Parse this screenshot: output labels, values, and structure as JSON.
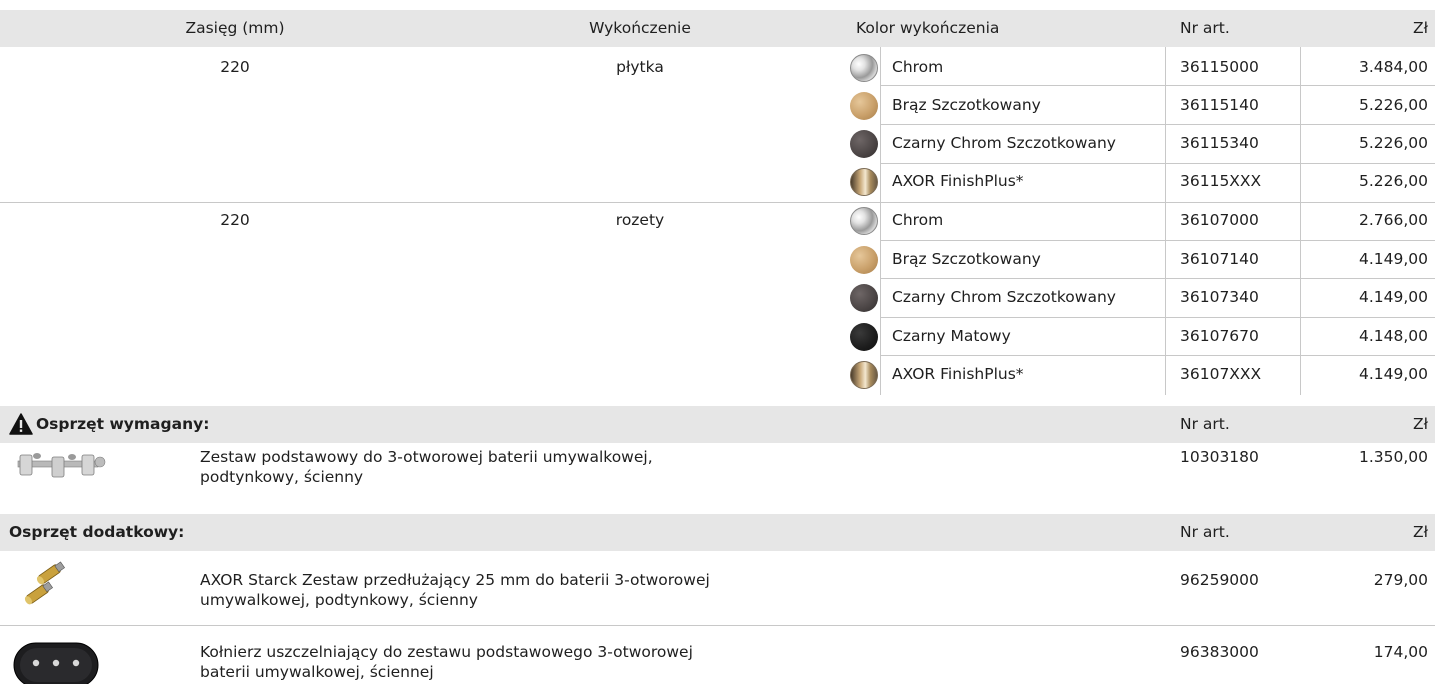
{
  "table_header": {
    "col_reach": "Zasięg (mm)",
    "col_finish": "Wykończenie",
    "col_color": "Kolor wykończenia",
    "col_art": "Nr art.",
    "col_price": "Zł"
  },
  "groups": [
    {
      "reach": "220",
      "finish": "płytka",
      "rows": [
        {
          "swatch": "chrom",
          "color": "Chrom",
          "art": "36115000",
          "price": "3.484,00"
        },
        {
          "swatch": "braz",
          "color": "Brąz Szczotkowany",
          "art": "36115140",
          "price": "5.226,00"
        },
        {
          "swatch": "czarny-chrom",
          "color": "Czarny Chrom Szczotkowany",
          "art": "36115340",
          "price": "5.226,00"
        },
        {
          "swatch": "finishplus",
          "color": "AXOR FinishPlus*",
          "art": "36115XXX",
          "price": "5.226,00"
        }
      ]
    },
    {
      "reach": "220",
      "finish": "rozety",
      "rows": [
        {
          "swatch": "chrom",
          "color": "Chrom",
          "art": "36107000",
          "price": "2.766,00"
        },
        {
          "swatch": "braz",
          "color": "Brąz Szczotkowany",
          "art": "36107140",
          "price": "4.149,00"
        },
        {
          "swatch": "czarny-chrom",
          "color": "Czarny Chrom Szczotkowany",
          "art": "36107340",
          "price": "4.149,00"
        },
        {
          "swatch": "czarny-mat",
          "color": "Czarny Matowy",
          "art": "36107670",
          "price": "4.148,00"
        },
        {
          "swatch": "finishplus",
          "color": "AXOR FinishPlus*",
          "art": "36107XXX",
          "price": "4.149,00"
        }
      ]
    }
  ],
  "required": {
    "title": "Osprzęt wymagany:",
    "col_art": "Nr art.",
    "col_price": "Zł",
    "icon": "warning-triangle-icon",
    "items": [
      {
        "image": "valve-set-image",
        "line1": "Zestaw podstawowy do 3-otworowej baterii umywalkowej,",
        "line2": "podtynkowy, ścienny",
        "art": "10303180",
        "price": "1.350,00"
      }
    ]
  },
  "additional": {
    "title": "Osprzęt dodatkowy:",
    "col_art": "Nr art.",
    "col_price": "Zł",
    "items": [
      {
        "image": "extension-set-image",
        "line1": "AXOR Starck Zestaw przedłużający 25 mm do baterii 3-otworowej",
        "line2": "umywalkowej, podtynkowy, ścienny",
        "art": "96259000",
        "price": "279,00"
      },
      {
        "image": "sealing-flange-image",
        "line1": "Kołnierz uszczelniający do zestawu podstawowego 3-otworowej",
        "line2": "baterii umywalkowej, ściennej",
        "art": "96383000",
        "price": "174,00"
      }
    ]
  }
}
